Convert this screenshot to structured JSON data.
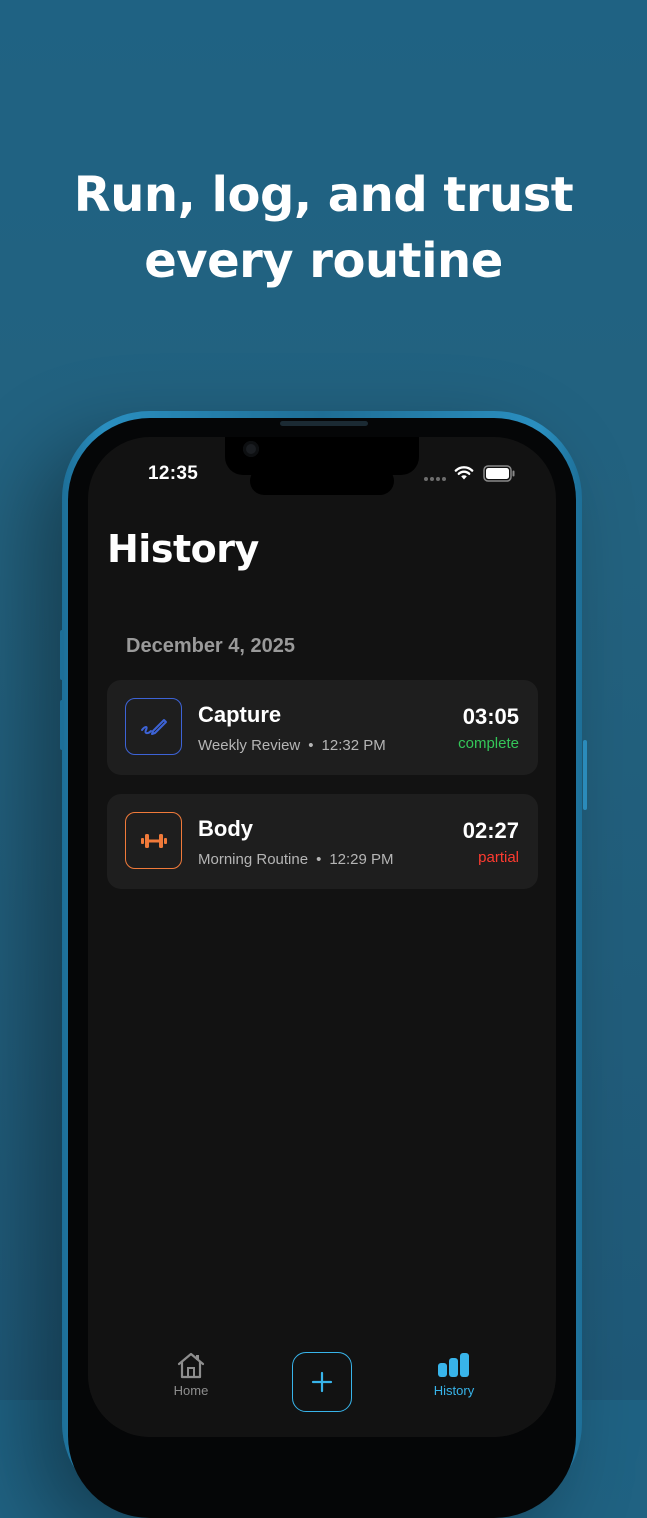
{
  "promo": {
    "headline_line1": "Run, log, and trust",
    "headline_line2": "every routine"
  },
  "status_bar": {
    "time": "12:35",
    "icons": [
      "wifi-icon",
      "battery-icon",
      "signal-dots-icon"
    ]
  },
  "page": {
    "title": "History"
  },
  "sections": [
    {
      "date": "December 4, 2025",
      "entries": [
        {
          "name": "Capture",
          "routine": "Weekly Review",
          "separator": "•",
          "time": "12:32 PM",
          "duration": "03:05",
          "status": "complete",
          "status_color": "#34c759",
          "icon": "pen-icon",
          "accent": "#3d63d6"
        },
        {
          "name": "Body",
          "routine": "Morning Routine",
          "separator": "•",
          "time": "12:29 PM",
          "duration": "02:27",
          "status": "partial",
          "status_color": "#ff3b30",
          "icon": "dumbbell-icon",
          "accent": "#f07a3a"
        }
      ]
    }
  ],
  "tabbar": {
    "home_label": "Home",
    "history_label": "History",
    "add_icon": "plus-icon",
    "active_color": "#38b4ea",
    "inactive_color": "#8e8e8e"
  },
  "colors": {
    "background": "#23627f",
    "screen": "#121212",
    "card": "#1e1e1e"
  }
}
